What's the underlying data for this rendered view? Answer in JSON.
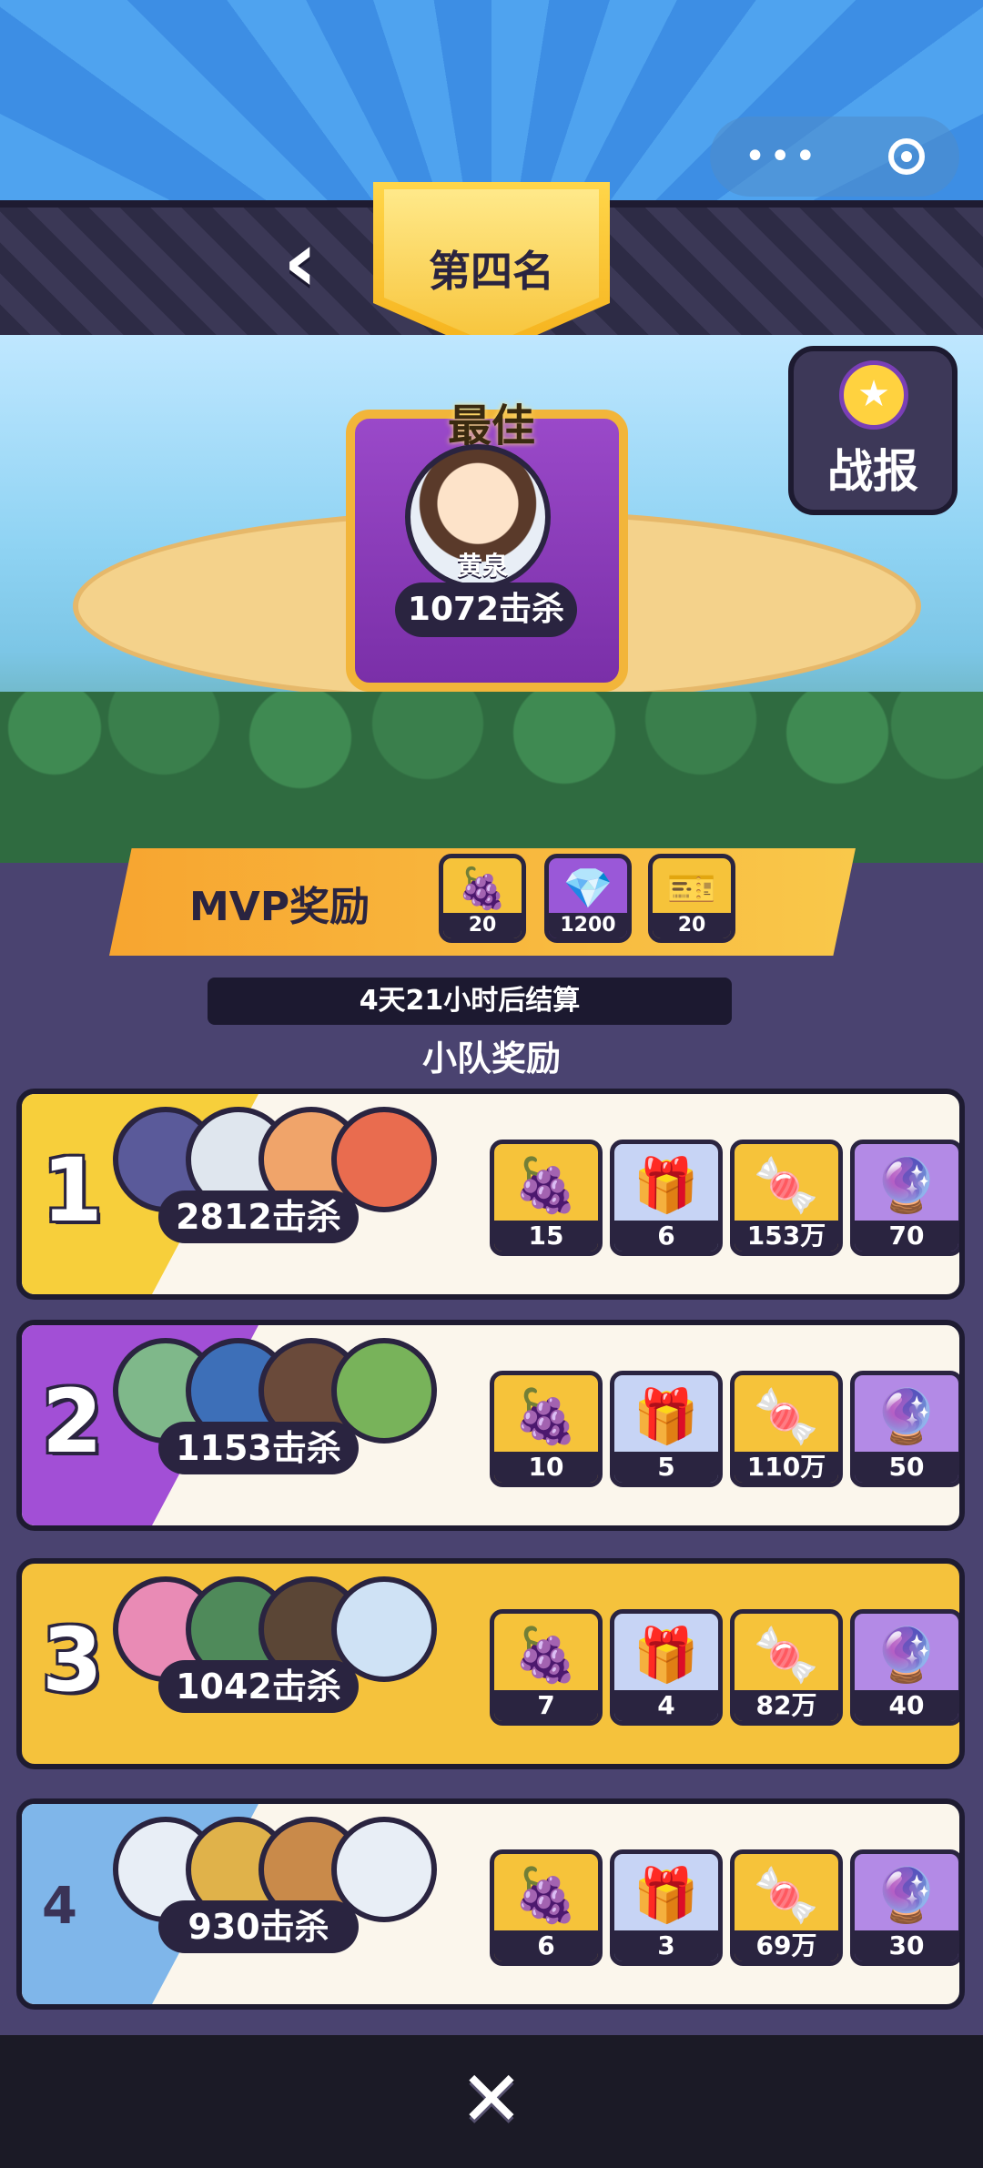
{
  "header": {
    "rank_title": "第四名",
    "back_icon": "chevron-left-icon"
  },
  "best": {
    "title": "最佳",
    "player_name": "黄泉",
    "kills": "1072击杀"
  },
  "zhanbao": {
    "label": "战报",
    "icon": "star-badge-icon"
  },
  "mvp": {
    "label": "MVP奖励",
    "rewards": [
      {
        "icon": "fruit-icon",
        "count": "20"
      },
      {
        "icon": "gem-icon",
        "count": "1200"
      },
      {
        "icon": "ticket-icon",
        "count": "20"
      }
    ]
  },
  "timer": "4天21小时后结算",
  "team_title": "小队奖励",
  "teams": [
    {
      "rank": "1",
      "kills": "2812击杀",
      "accent": "#f7cf3b",
      "rewards": [
        {
          "icon": "fruit-icon",
          "count": "15"
        },
        {
          "icon": "mystery-box-icon",
          "count": "6"
        },
        {
          "icon": "candy-icon",
          "count": "153万"
        },
        {
          "icon": "capsule-icon",
          "count": "70"
        }
      ]
    },
    {
      "rank": "2",
      "kills": "1153击杀",
      "accent": "#a24fd6",
      "rewards": [
        {
          "icon": "fruit-icon",
          "count": "10"
        },
        {
          "icon": "mystery-box-icon",
          "count": "5"
        },
        {
          "icon": "candy-icon",
          "count": "110万"
        },
        {
          "icon": "capsule-icon",
          "count": "50"
        }
      ]
    },
    {
      "rank": "3",
      "kills": "1042击杀",
      "accent": "#f5c23c",
      "rewards": [
        {
          "icon": "fruit-icon",
          "count": "7"
        },
        {
          "icon": "mystery-box-icon",
          "count": "4"
        },
        {
          "icon": "candy-icon",
          "count": "82万"
        },
        {
          "icon": "capsule-icon",
          "count": "40"
        }
      ]
    },
    {
      "rank": "4",
      "kills": "930击杀",
      "accent": "#7fb6ea",
      "rewards": [
        {
          "icon": "fruit-icon",
          "count": "6"
        },
        {
          "icon": "mystery-box-icon",
          "count": "3"
        },
        {
          "icon": "candy-icon",
          "count": "69万"
        },
        {
          "icon": "capsule-icon",
          "count": "30"
        }
      ]
    }
  ],
  "close_icon": "close-icon"
}
